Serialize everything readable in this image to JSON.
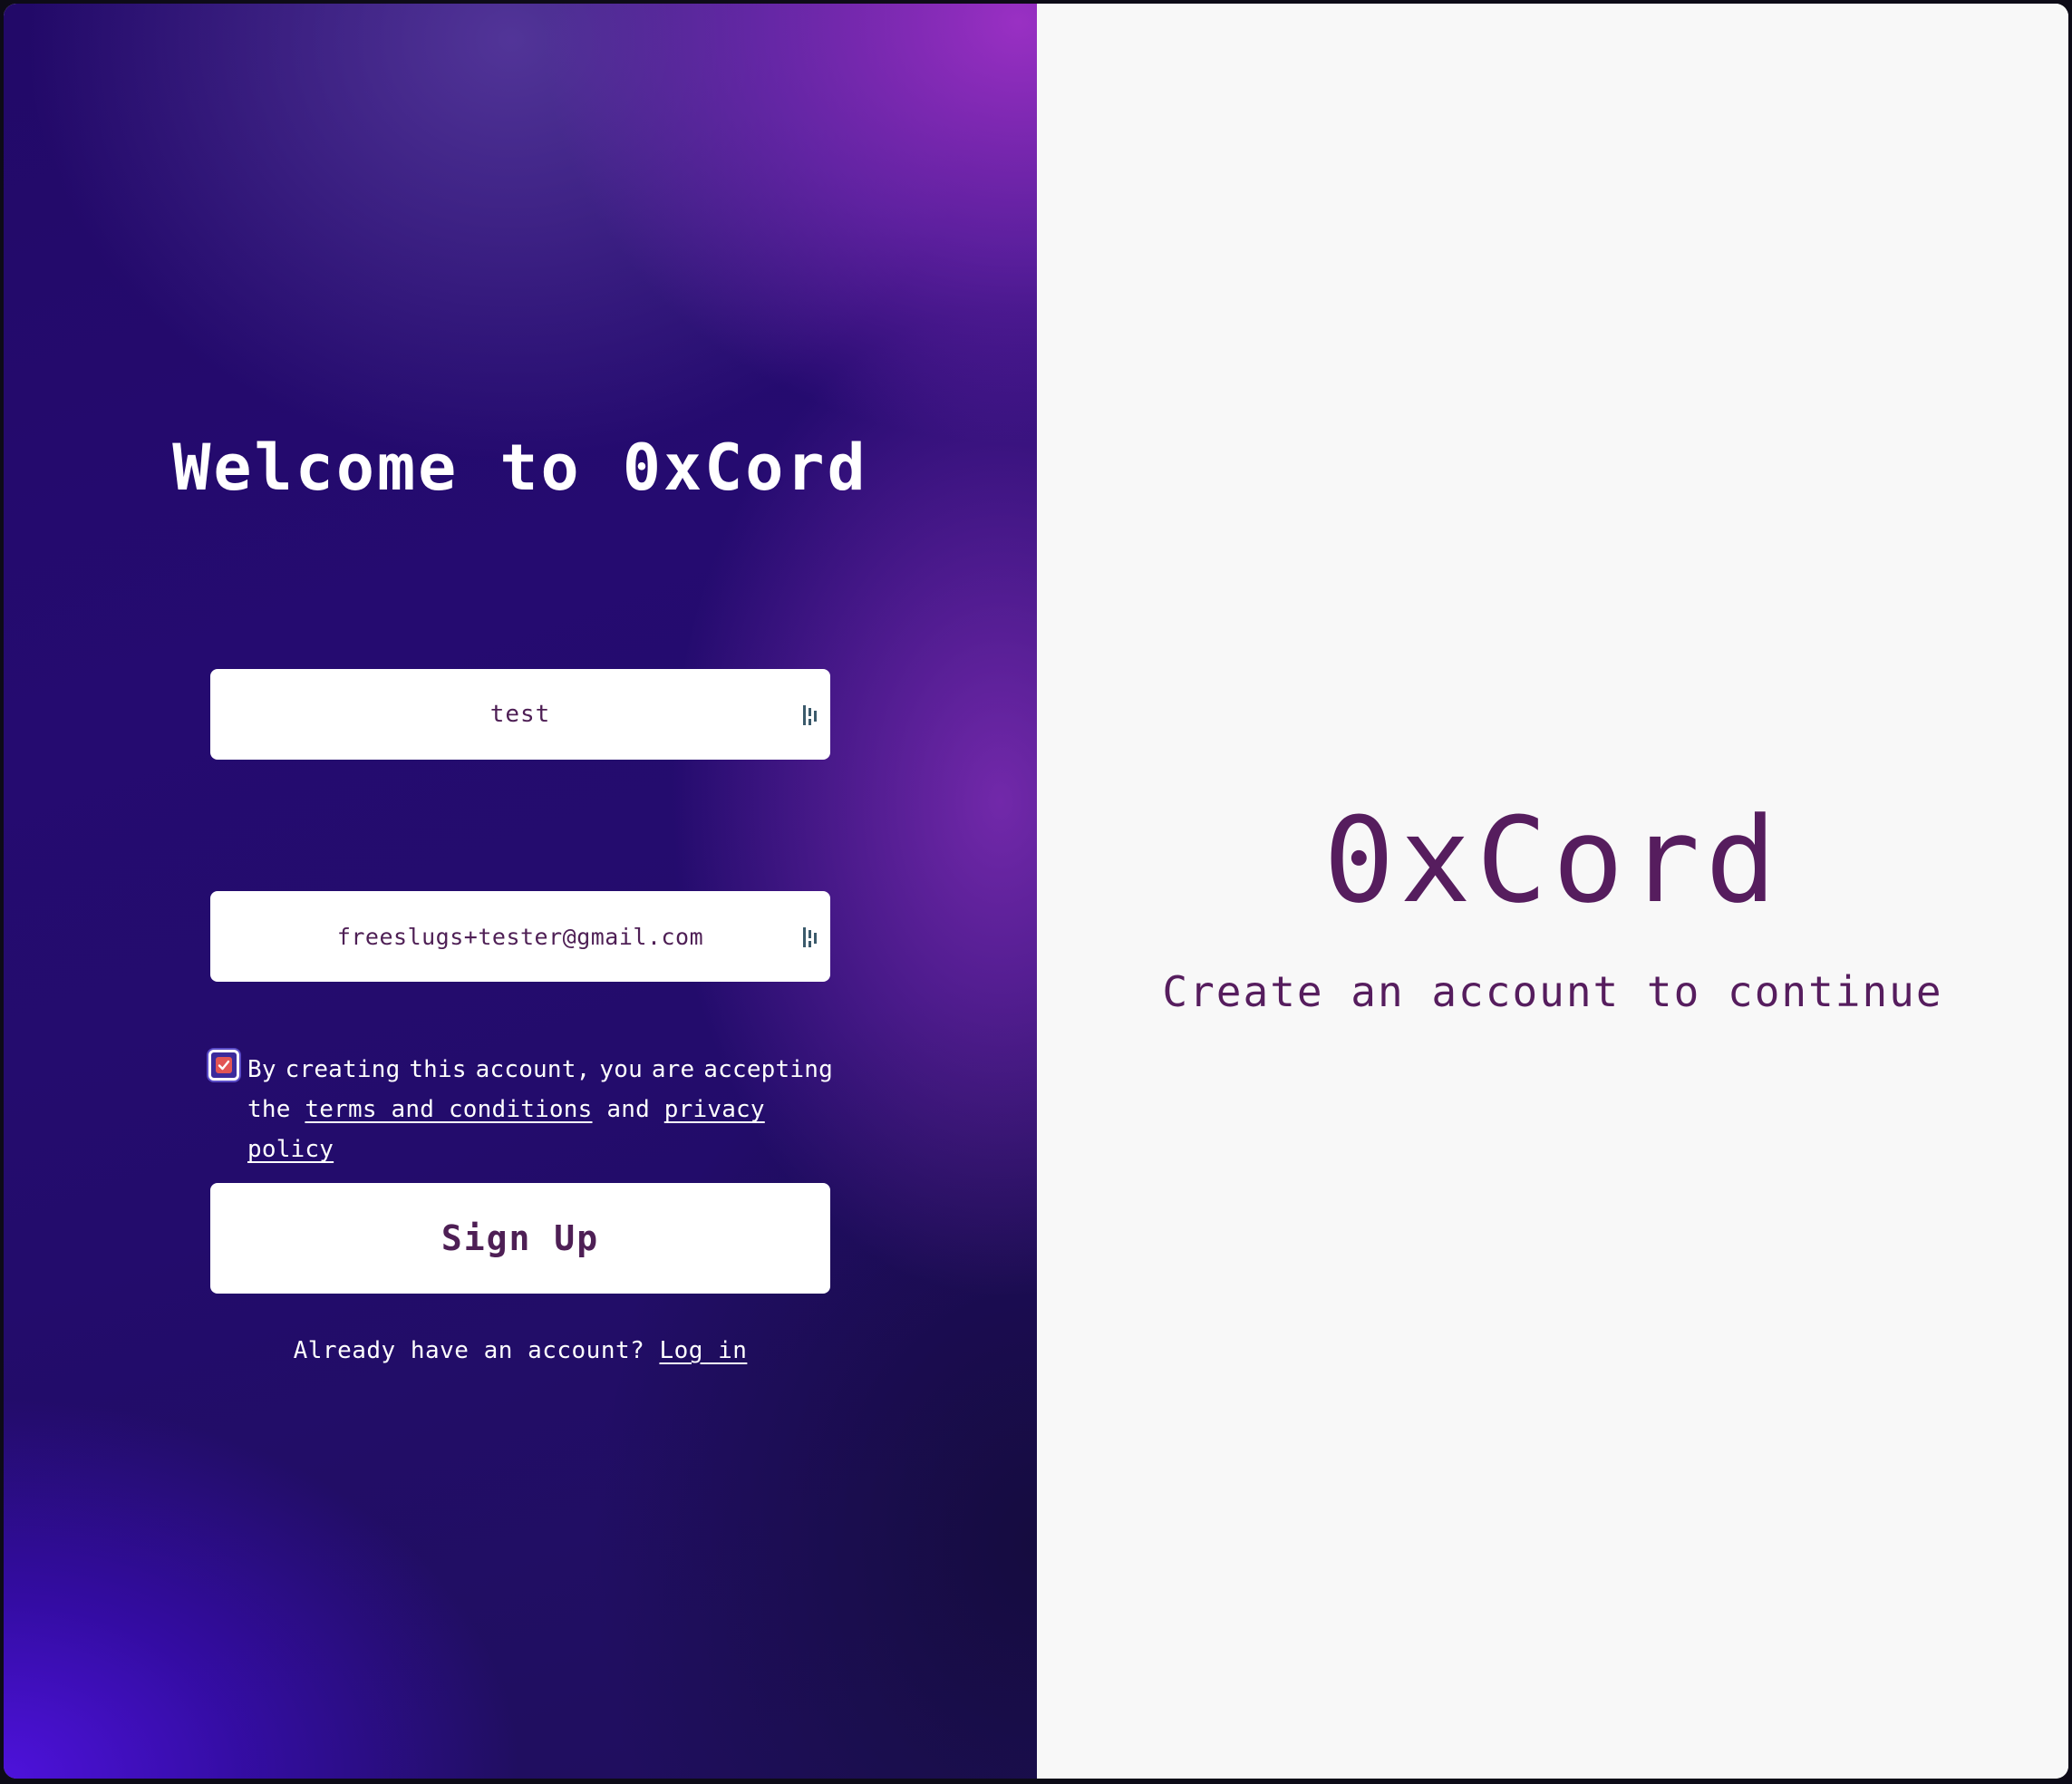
{
  "signup": {
    "title": "Welcome to 0xCord",
    "username_value": "test",
    "email_value": "freeslugs+tester@gmail.com",
    "consent": {
      "checked": true,
      "line1_words": [
        "By",
        "creating",
        "this",
        "account,",
        "you",
        "are",
        "accepting"
      ],
      "prefix": "the",
      "terms_link": "terms and conditions",
      "conjunction": "and",
      "privacy_link": "privacy policy"
    },
    "signup_button": "Sign Up",
    "login_prompt": "Already have an account?",
    "login_link": "Log in"
  },
  "brand_panel": {
    "brand_name": "0xCord",
    "subtitle": "Create an account to continue"
  },
  "icons": {
    "field_icon": "password-manager-icon"
  },
  "colors": {
    "accent": "#561d5e",
    "panel_bg": "#f8f8f8",
    "checkbox_fill": "#e25555"
  }
}
